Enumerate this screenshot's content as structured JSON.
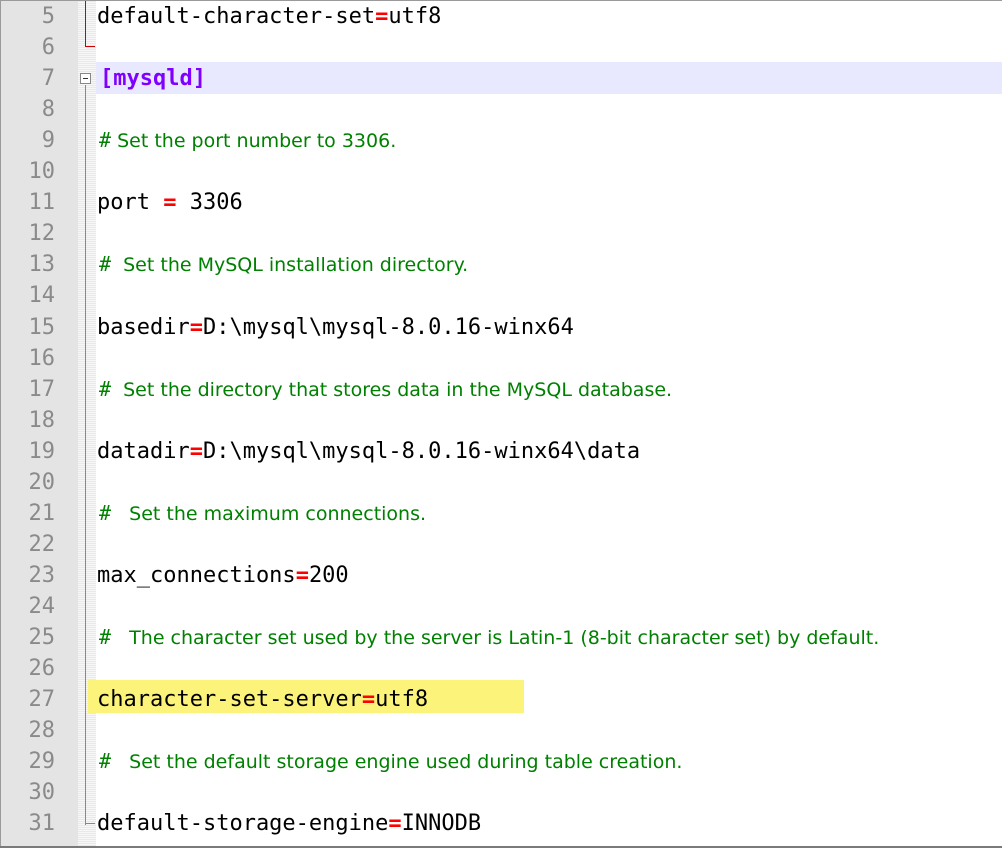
{
  "editor": {
    "language": "ini",
    "colors": {
      "line_number": "#8a8a8a",
      "comment": "#008000",
      "operator": "#ff0000",
      "section": "#8000ff",
      "highlight": "#fbf37a",
      "current_line": "#e8e8ff"
    },
    "lines": [
      {
        "num": "5",
        "type": "kv",
        "key": "default-character-set",
        "op": "=",
        "value": "utf8"
      },
      {
        "num": "6",
        "type": "blank"
      },
      {
        "num": "7",
        "type": "section",
        "text": "[mysqld]"
      },
      {
        "num": "8",
        "type": "blank"
      },
      {
        "num": "9",
        "type": "comment",
        "hash": "#",
        "text": " Set the port number to 3306."
      },
      {
        "num": "10",
        "type": "blank"
      },
      {
        "num": "11",
        "type": "kv",
        "key": "port ",
        "op": "=",
        "value": " 3306"
      },
      {
        "num": "12",
        "type": "blank"
      },
      {
        "num": "13",
        "type": "comment",
        "hash": "#",
        "text": "  Set the MySQL installation directory."
      },
      {
        "num": "14",
        "type": "blank"
      },
      {
        "num": "15",
        "type": "kv",
        "key": "basedir",
        "op": "=",
        "value": "D:\\mysql\\mysql-8.0.16-winx64"
      },
      {
        "num": "16",
        "type": "blank"
      },
      {
        "num": "17",
        "type": "comment",
        "hash": "#",
        "text": "  Set the directory that stores data in the MySQL database."
      },
      {
        "num": "18",
        "type": "blank"
      },
      {
        "num": "19",
        "type": "kv",
        "key": "datadir",
        "op": "=",
        "value": "D:\\mysql\\mysql-8.0.16-winx64\\data"
      },
      {
        "num": "20",
        "type": "blank"
      },
      {
        "num": "21",
        "type": "comment",
        "hash": "#",
        "text": "   Set the maximum connections."
      },
      {
        "num": "22",
        "type": "blank"
      },
      {
        "num": "23",
        "type": "kv",
        "key": "max_connections",
        "op": "=",
        "value": "200"
      },
      {
        "num": "24",
        "type": "blank"
      },
      {
        "num": "25",
        "type": "comment",
        "hash": "#",
        "text": "   The character set used by the server is Latin-1 (8-bit character set) by default."
      },
      {
        "num": "26",
        "type": "blank"
      },
      {
        "num": "27",
        "type": "kv",
        "key": "character-set-server",
        "op": "=",
        "value": "utf8",
        "highlighted": true
      },
      {
        "num": "28",
        "type": "blank"
      },
      {
        "num": "29",
        "type": "comment",
        "hash": "#",
        "text": "   Set the default storage engine used during table creation."
      },
      {
        "num": "30",
        "type": "blank"
      },
      {
        "num": "31",
        "type": "kv",
        "key": "default-storage-engine",
        "op": "=",
        "value": "INNODB"
      }
    ]
  }
}
